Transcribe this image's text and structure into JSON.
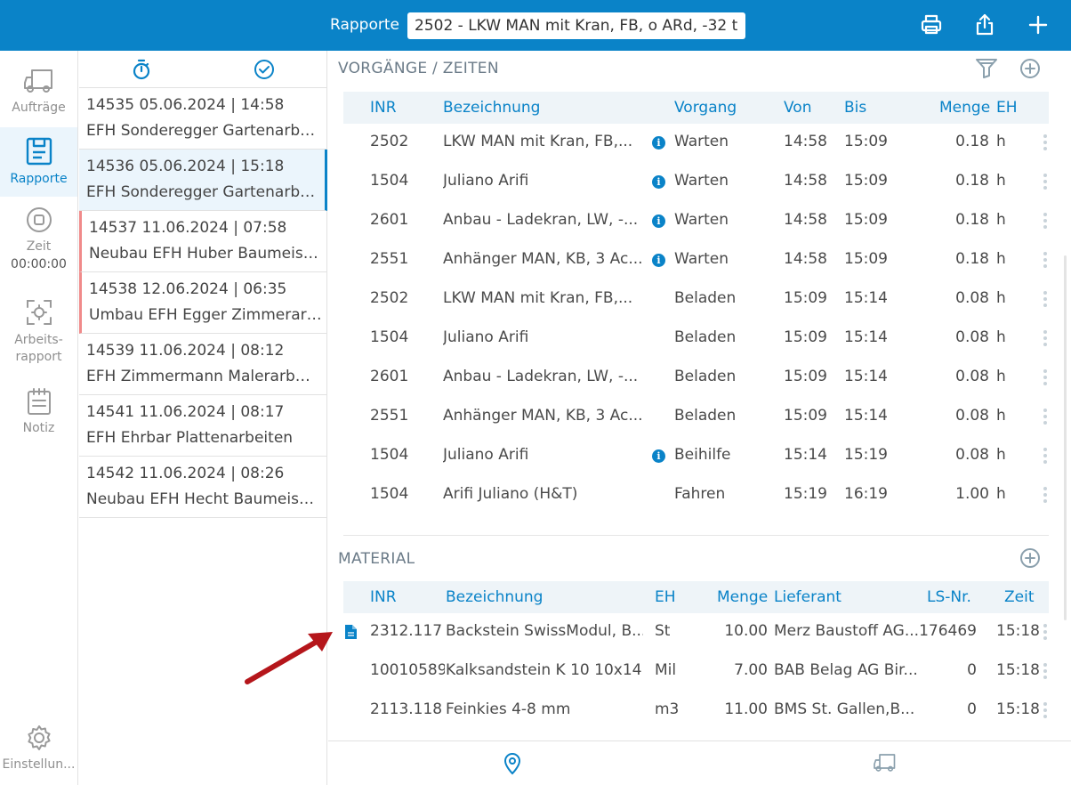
{
  "header": {
    "title": "Rapporte",
    "selected_vehicle": "2502 - LKW MAN mit Kran, FB, o ARd, -32 t"
  },
  "nav": {
    "items": [
      {
        "label": "Aufträge",
        "icon": "truck-icon"
      },
      {
        "label": "Rapporte",
        "icon": "report-icon"
      },
      {
        "label": "Zeit",
        "icon": "stop-timer-icon",
        "value": "00:00:00"
      },
      {
        "label": "Arbeits-\nrapport",
        "icon": "scan-icon"
      },
      {
        "label": "Notiz",
        "icon": "notepad-icon"
      },
      {
        "label": "Einstellun...",
        "icon": "gear-icon"
      }
    ]
  },
  "reports": [
    {
      "line1": "14535  05.06.2024 | 14:58",
      "line2": "EFH Sonderegger Gartenarbeiten"
    },
    {
      "line1": "14536  05.06.2024 | 15:18",
      "line2": "EFH Sonderegger Gartenarbeiten"
    },
    {
      "line1": "14537  11.06.2024 | 07:58",
      "line2": "Neubau EFH Huber Baumeisterarbeiten"
    },
    {
      "line1": "14538  12.06.2024 | 06:35",
      "line2": "Umbau EFH Egger Zimmerarbeiten"
    },
    {
      "line1": "14539  11.06.2024 | 08:12",
      "line2": "EFH Zimmermann Malerarbeiten"
    },
    {
      "line1": "14541  11.06.2024 | 08:17",
      "line2": "EFH Ehrbar Plattenarbeiten"
    },
    {
      "line1": "14542  11.06.2024 | 08:26",
      "line2": "Neubau EFH Hecht Baumeisterarbeiten"
    }
  ],
  "vorgaenge": {
    "title": "VORGÄNGE / ZEITEN",
    "columns": {
      "inr": "INR",
      "bezeichnung": "Bezeichnung",
      "vorgang": "Vorgang",
      "von": "Von",
      "bis": "Bis",
      "menge": "Menge",
      "eh": "EH"
    },
    "rows": [
      {
        "inr": "2502",
        "bez": "LKW MAN mit Kran, FB,...",
        "info": true,
        "vorgang": "Warten",
        "von": "14:58",
        "bis": "15:09",
        "menge": "0.18",
        "eh": "h"
      },
      {
        "inr": "1504",
        "bez": "Juliano Arifi",
        "info": true,
        "vorgang": "Warten",
        "von": "14:58",
        "bis": "15:09",
        "menge": "0.18",
        "eh": "h"
      },
      {
        "inr": "2601",
        "bez": "Anbau - Ladekran, LW, -...",
        "info": true,
        "vorgang": "Warten",
        "von": "14:58",
        "bis": "15:09",
        "menge": "0.18",
        "eh": "h"
      },
      {
        "inr": "2551",
        "bez": "Anhänger MAN, KB, 3 Ac...",
        "info": true,
        "vorgang": "Warten",
        "von": "14:58",
        "bis": "15:09",
        "menge": "0.18",
        "eh": "h"
      },
      {
        "inr": "2502",
        "bez": "LKW MAN mit Kran, FB,...",
        "info": false,
        "vorgang": "Beladen",
        "von": "15:09",
        "bis": "15:14",
        "menge": "0.08",
        "eh": "h"
      },
      {
        "inr": "1504",
        "bez": "Juliano Arifi",
        "info": false,
        "vorgang": "Beladen",
        "von": "15:09",
        "bis": "15:14",
        "menge": "0.08",
        "eh": "h"
      },
      {
        "inr": "2601",
        "bez": "Anbau - Ladekran, LW, -...",
        "info": false,
        "vorgang": "Beladen",
        "von": "15:09",
        "bis": "15:14",
        "menge": "0.08",
        "eh": "h"
      },
      {
        "inr": "2551",
        "bez": "Anhänger MAN, KB, 3 Ac...",
        "info": false,
        "vorgang": "Beladen",
        "von": "15:09",
        "bis": "15:14",
        "menge": "0.08",
        "eh": "h"
      },
      {
        "inr": "1504",
        "bez": "Juliano Arifi",
        "info": true,
        "vorgang": "Beihilfe",
        "von": "15:14",
        "bis": "15:19",
        "menge": "0.08",
        "eh": "h"
      },
      {
        "inr": "1504",
        "bez": "Arifi Juliano (H&T)",
        "info": false,
        "vorgang": "Fahren",
        "von": "15:19",
        "bis": "16:19",
        "menge": "1.00",
        "eh": "h"
      }
    ]
  },
  "material": {
    "title": "MATERIAL",
    "columns": {
      "inr": "INR",
      "bezeichnung": "Bezeichnung",
      "eh": "EH",
      "menge": "Menge",
      "lieferant": "Lieferant",
      "ls": "LS-Nr.",
      "zeit": "Zeit"
    },
    "rows": [
      {
        "doc": true,
        "inr": "2312.117",
        "bez": "Backstein SwissModul, B...",
        "eh": "St",
        "menge": "10.00",
        "lieferant": "Merz Baustoff AG...",
        "ls": "176469",
        "zeit": "15:18"
      },
      {
        "doc": false,
        "inr": "10010589",
        "bez": "Kalksandstein K 10 10x14...",
        "eh": "Mil",
        "menge": "7.00",
        "lieferant": "BAB Belag AG Bir...",
        "ls": "0",
        "zeit": "15:18"
      },
      {
        "doc": false,
        "inr": "2113.118",
        "bez": "Feinkies 4-8 mm",
        "eh": "m3",
        "menge": "11.00",
        "lieferant": "BMS St. Gallen,B...",
        "ls": "0",
        "zeit": "15:18"
      }
    ]
  },
  "colors": {
    "accent": "#0a83c8",
    "annotation_arrow": "#b5161b",
    "flag": "#f08a8a"
  }
}
